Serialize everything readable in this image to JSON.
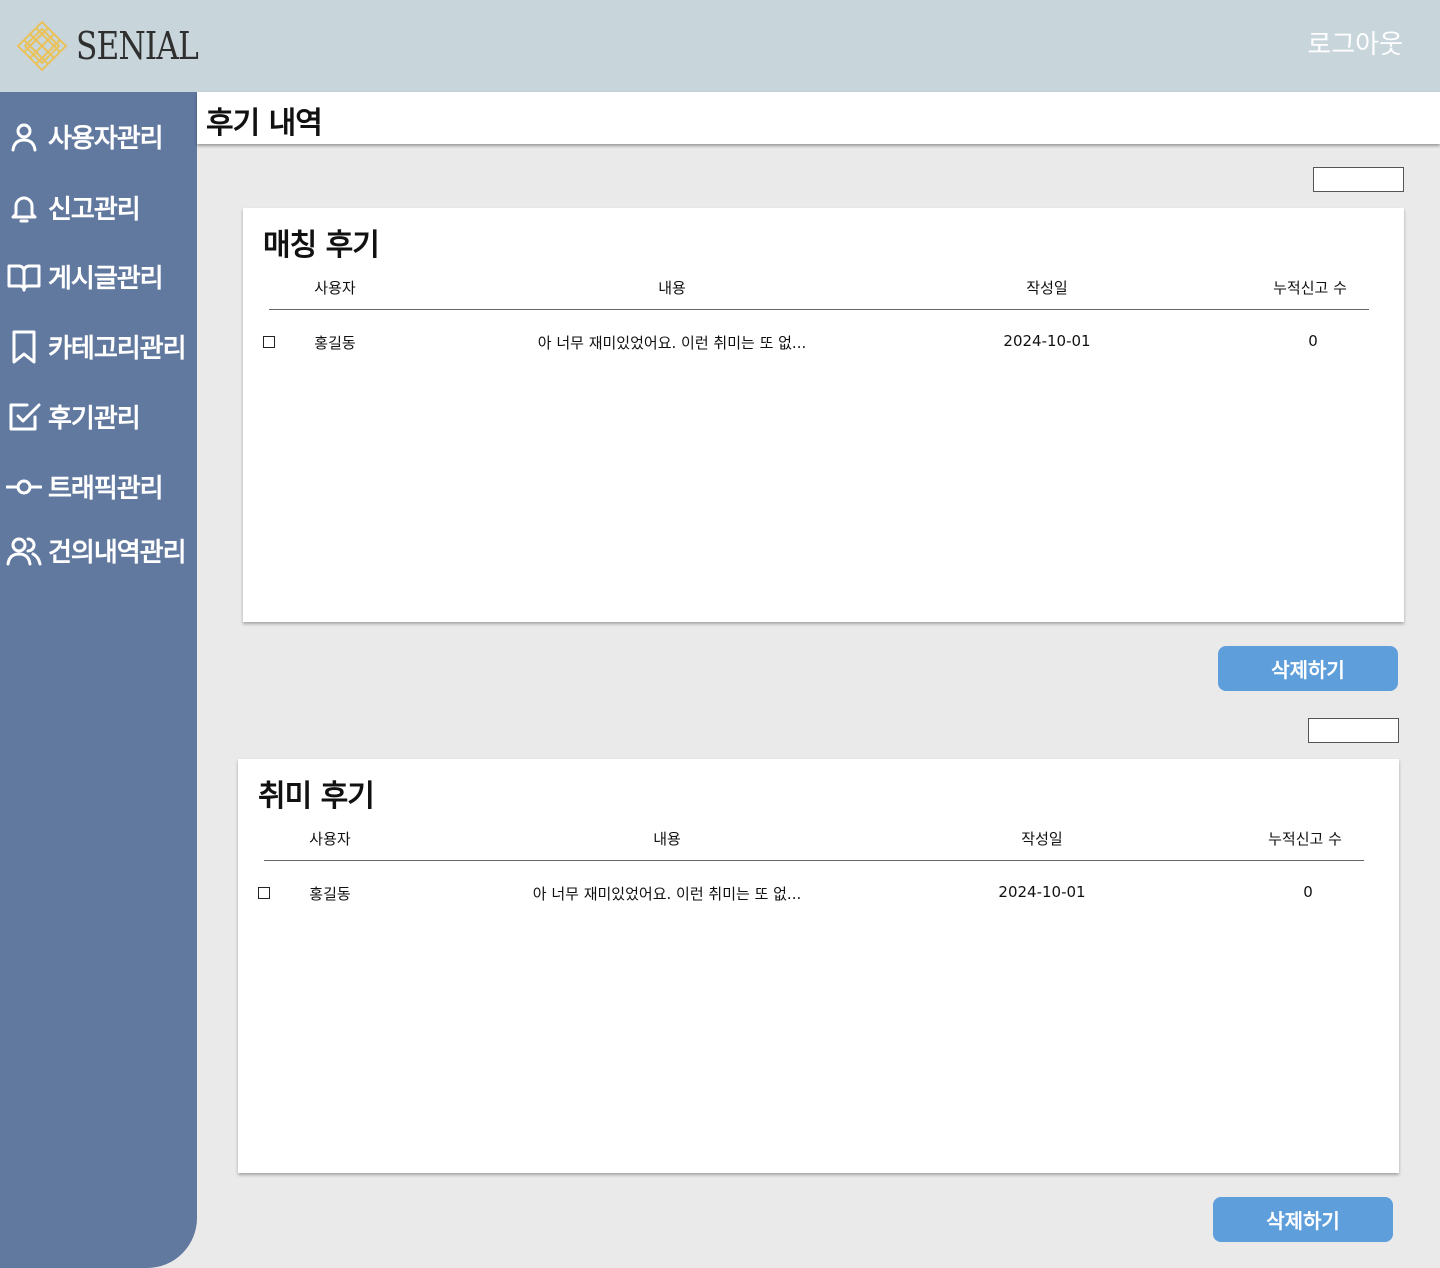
{
  "header": {
    "logo_text": "SENIAL",
    "logout_label": "로그아웃"
  },
  "sidebar": {
    "items": [
      {
        "label": "사용자관리",
        "icon": "user-icon"
      },
      {
        "label": "신고관리",
        "icon": "bell-icon"
      },
      {
        "label": "게시글관리",
        "icon": "book-icon"
      },
      {
        "label": "카테고리관리",
        "icon": "bookmark-icon"
      },
      {
        "label": "후기관리",
        "icon": "checkbox-icon"
      },
      {
        "label": "트래픽관리",
        "icon": "commit-icon"
      },
      {
        "label": "건의내역관리",
        "icon": "users-icon"
      }
    ]
  },
  "page": {
    "title": "후기 내역"
  },
  "sections": [
    {
      "title": "매칭 후기",
      "columns": [
        "사용자",
        "내용",
        "작성일",
        "누적신고 수"
      ],
      "rows": [
        {
          "user": "홍길동",
          "content": "아 너무 재미있었어요. 이런 취미는 또 없...",
          "date": "2024-10-01",
          "reports": "0"
        }
      ],
      "delete_label": "삭제하기"
    },
    {
      "title": "취미 후기",
      "columns": [
        "사용자",
        "내용",
        "작성일",
        "누적신고 수"
      ],
      "rows": [
        {
          "user": "홍길동",
          "content": "아 너무 재미있었어요. 이런 취미는 또 없...",
          "date": "2024-10-01",
          "reports": "0"
        }
      ],
      "delete_label": "삭제하기"
    }
  ],
  "colors": {
    "header_bg": "#c8d6dc",
    "sidebar_bg": "#62799f",
    "button_bg": "#5e9fdb",
    "content_bg": "#eaeaea"
  }
}
